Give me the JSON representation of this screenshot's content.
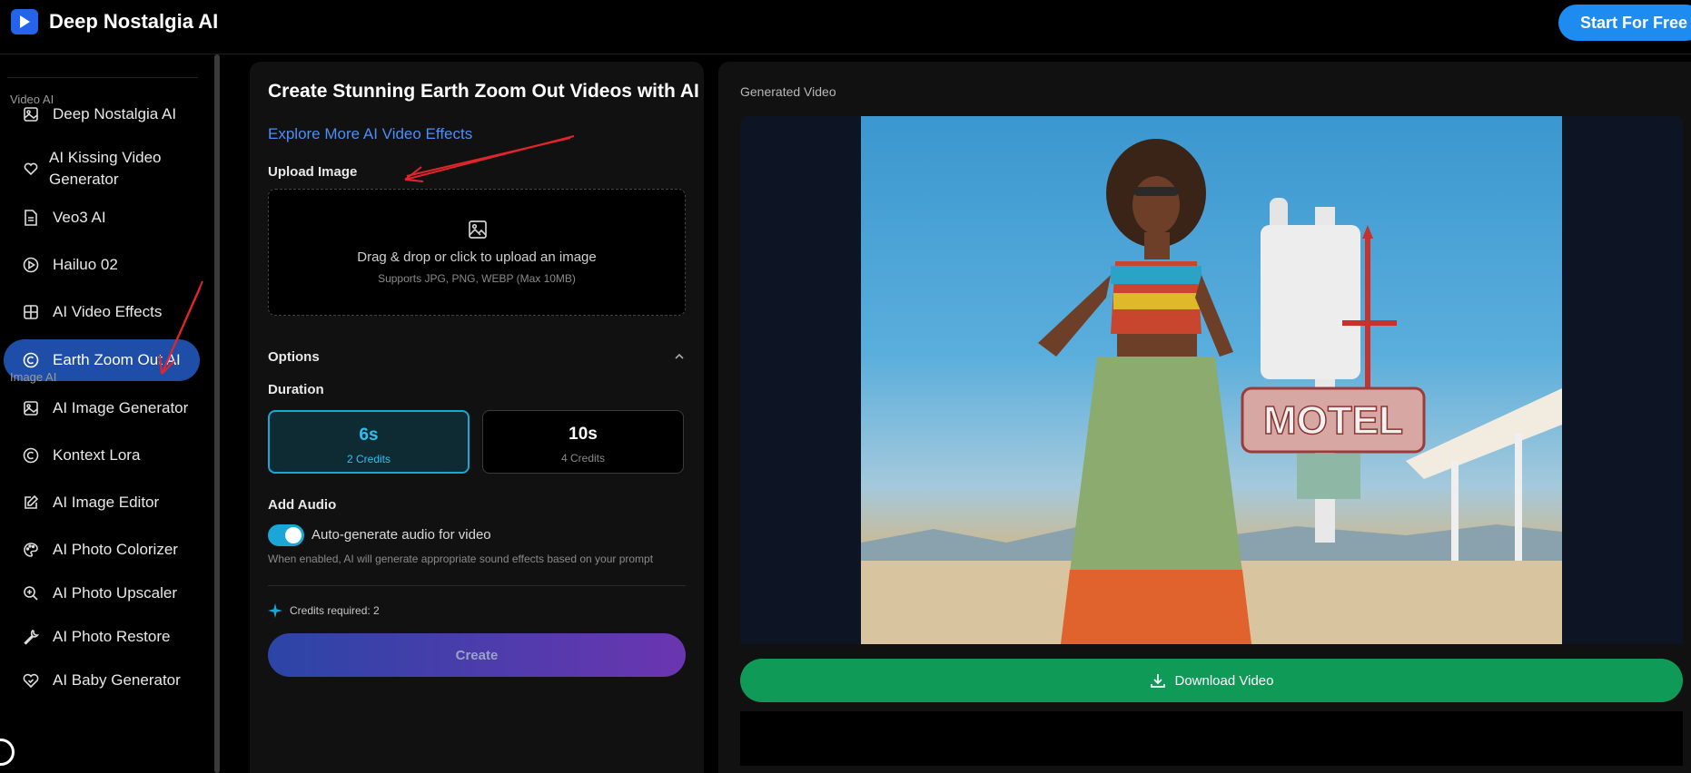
{
  "header": {
    "brand_name": "Deep Nostalgia AI",
    "start_button": "Start For Free"
  },
  "sidebar": {
    "sections": {
      "video_ai": "Video AI",
      "image_ai": "Image AI"
    },
    "video_items": [
      {
        "label": "Deep Nostalgia AI",
        "icon": "image-icon"
      },
      {
        "label": "AI Kissing Video Generator",
        "icon": "heart-icon"
      },
      {
        "label": "Veo3 AI",
        "icon": "document-icon"
      },
      {
        "label": "Hailuo 02",
        "icon": "play-circle-icon"
      },
      {
        "label": "AI Video Effects",
        "icon": "grid-effects-icon"
      },
      {
        "label": "Earth Zoom Out AI",
        "icon": "circle-c-icon",
        "active": true
      }
    ],
    "image_items": [
      {
        "label": "AI Image Generator",
        "icon": "image-icon"
      },
      {
        "label": "Kontext Lora",
        "icon": "circle-c-icon"
      },
      {
        "label": "AI Image Editor",
        "icon": "edit-icon"
      },
      {
        "label": "AI Photo Colorizer",
        "icon": "palette-icon"
      },
      {
        "label": "AI Photo Upscaler",
        "icon": "zoom-in-icon"
      },
      {
        "label": "AI Photo Restore",
        "icon": "wrench-icon"
      },
      {
        "label": "AI Baby Generator",
        "icon": "heart-icon"
      }
    ]
  },
  "create_panel": {
    "title": "Create Stunning Earth Zoom Out Videos with AI",
    "explore_link": "Explore More AI Video Effects",
    "upload": {
      "label": "Upload Image",
      "main_text": "Drag & drop or click to upload an image",
      "sub_text": "Supports JPG, PNG, WEBP (Max 10MB)"
    },
    "options_label": "Options",
    "duration": {
      "label": "Duration",
      "choices": [
        {
          "value": "6s",
          "credits": "2 Credits",
          "selected": true
        },
        {
          "value": "10s",
          "credits": "4 Credits",
          "selected": false
        }
      ]
    },
    "audio": {
      "label": "Add Audio",
      "toggle_label": "Auto-generate audio for video",
      "hint": "When enabled, AI will generate appropriate sound effects based on your prompt",
      "enabled": true
    },
    "credits_required": "Credits required: 2",
    "create_button": "Create"
  },
  "result_panel": {
    "label": "Generated Video",
    "download_button": "Download Video",
    "image_sign_text": "MOTEL"
  },
  "colors": {
    "accent_blue": "#1d8bf0",
    "active_nav": "#1e4ea8",
    "selected_cyan": "#1aa7d8",
    "download_green": "#0f9b57",
    "annotation_red": "#e0262b"
  }
}
